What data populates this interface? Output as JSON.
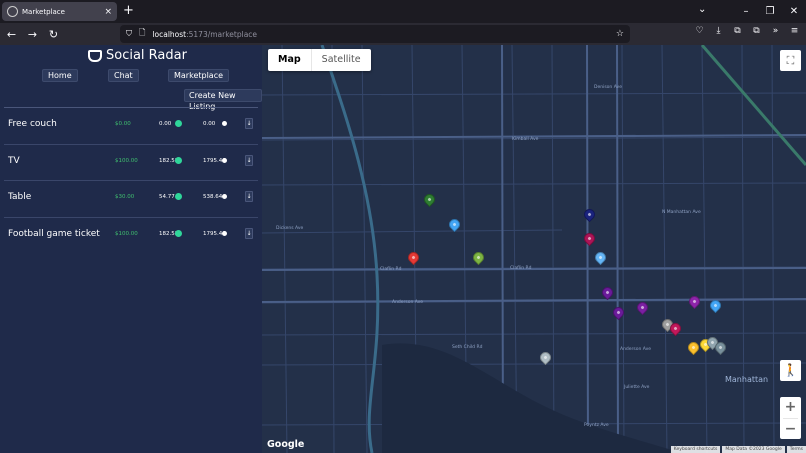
{
  "browser": {
    "tab_title": "Marketplace",
    "tab_close": "×",
    "new_tab": "+",
    "url_host": "localhost",
    "url_path": ":5173/marketplace",
    "win_min": "–",
    "win_restore": "❐",
    "win_close": "✕",
    "icons": {
      "back": "←",
      "forward": "→",
      "reload": "↻",
      "shield": "⛉",
      "page": "🗋",
      "star": "☆",
      "tabs_list": "⌄",
      "save": "♡",
      "download": "⤓",
      "extension": "⧉",
      "overflow": "»",
      "menu": "≡"
    }
  },
  "app": {
    "brand": "Social Radar",
    "nav": [
      "Home",
      "Chat",
      "Marketplace"
    ],
    "create_label": "Create New Listing",
    "listings": [
      {
        "title": "Free couch",
        "price": "$0.00",
        "v1": "0.00",
        "v2": "0.00",
        "btn": "↓"
      },
      {
        "title": "TV",
        "price": "$100.00",
        "v1": "182.58",
        "v2": "1795.46",
        "btn": "↓"
      },
      {
        "title": "Table",
        "price": "$30.00",
        "v1": "54.77",
        "v2": "538.64",
        "btn": "↓"
      },
      {
        "title": "Football game ticket",
        "price": "$100.00",
        "v1": "182.58",
        "v2": "1795.46",
        "btn": "↓"
      }
    ]
  },
  "map": {
    "type_map": "Map",
    "type_satellite": "Satellite",
    "google": "Google",
    "attrib": [
      "Keyboard shortcuts",
      "Map Data ©2023 Google",
      "Terms"
    ],
    "zoom_in": "+",
    "zoom_out": "−",
    "fullscreen_icon": "⛶",
    "pegman_icon": "🚶",
    "labels": {
      "city": "Manhattan",
      "kimball": "Kimball Ave",
      "claflin_w": "Claflin Rd",
      "claflin_e": "Claflin Rd",
      "anderson_w": "Anderson Ave",
      "anderson_e": "Anderson Ave",
      "dickens": "Dickens Ave",
      "poyntz": "Poyntz Ave",
      "denison": "Denison Ave",
      "seth": "Seth Child Rd",
      "manhattan_ave": "N Manhattan Ave",
      "juliette": "Juliette Ave"
    },
    "pins": [
      {
        "color": "#2e7d32"
      },
      {
        "color": "#42a5f5"
      },
      {
        "color": "#e53935"
      },
      {
        "color": "#7cb342"
      },
      {
        "color": "#1a237e"
      },
      {
        "color": "#ad1457"
      },
      {
        "color": "#64b5f6"
      },
      {
        "color": "#6a1b9a"
      },
      {
        "color": "#6a1b9a"
      },
      {
        "color": "#7b1fa2"
      },
      {
        "color": "#8e24aa"
      },
      {
        "color": "#42a5f5"
      },
      {
        "color": "#9e9e9e"
      },
      {
        "color": "#c2185b"
      },
      {
        "color": "#fbc02d"
      },
      {
        "color": "#fdd835"
      },
      {
        "color": "#90a4ae"
      },
      {
        "color": "#78909c"
      },
      {
        "color": "#b0bec5"
      }
    ]
  }
}
